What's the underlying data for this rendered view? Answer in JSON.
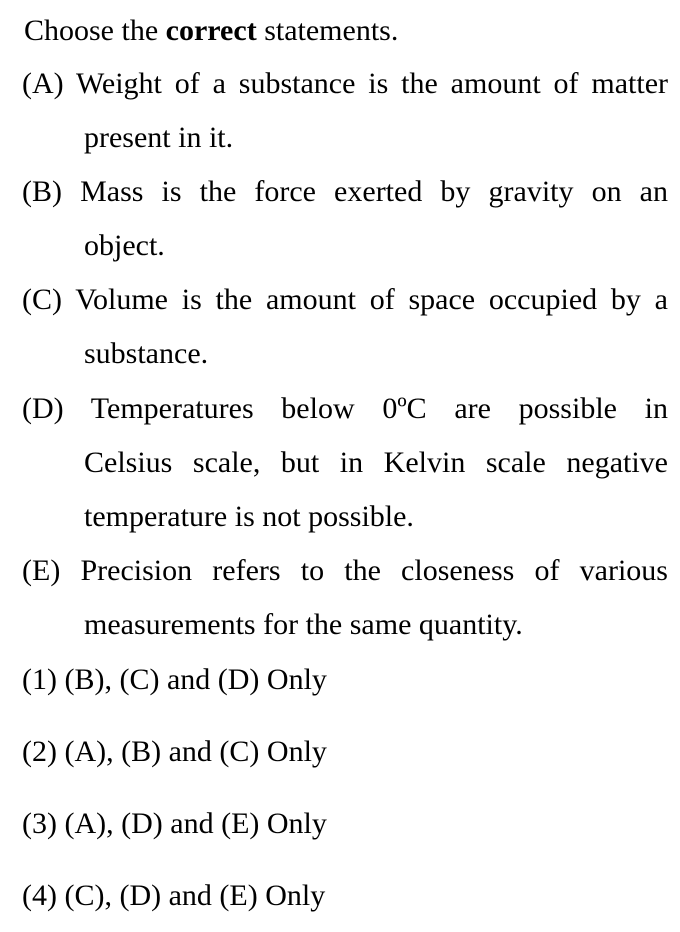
{
  "question": {
    "prefix": "Choose the ",
    "emphasis": "correct",
    "suffix": " statements."
  },
  "statements": [
    {
      "lines": [
        "(A) Weight of a substance is the amount of matter",
        "present in it."
      ]
    },
    {
      "lines": [
        "(B) Mass is the force exerted by gravity on an",
        "object."
      ]
    },
    {
      "lines": [
        "(C) Volume is the amount of space occupied by a",
        "substance."
      ]
    },
    {
      "lines": [
        "(D) Temperatures below 0ºC are possible in",
        "Celsius scale, but in Kelvin scale negative",
        "temperature is not possible."
      ]
    },
    {
      "lines": [
        "(E) Precision refers to the closeness of various",
        "measurements for the same quantity."
      ]
    }
  ],
  "options": [
    "(1) (B), (C) and (D) Only",
    "(2) (A), (B) and (C) Only",
    "(3) (A), (D) and (E) Only",
    "(4) (C), (D) and (E) Only"
  ]
}
